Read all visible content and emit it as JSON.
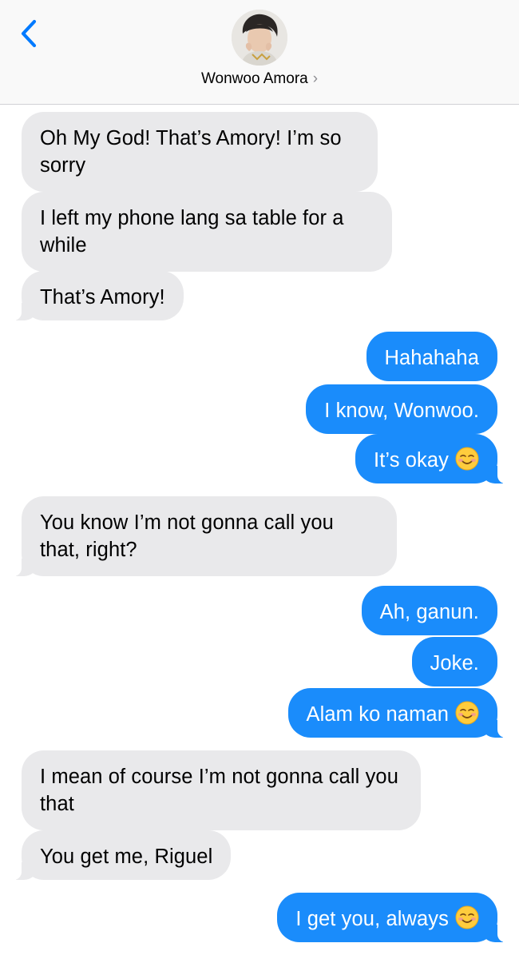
{
  "header": {
    "contact_name": "Wonwoo Amora",
    "chevron": "›"
  },
  "icons": {
    "back": "back-chevron-icon",
    "avatar": "contact-avatar",
    "emoji": "smiling-face-emoji"
  },
  "colors": {
    "outgoing": "#1a8cfb",
    "incoming": "#e9e9eb",
    "accent": "#007aff"
  },
  "messages": [
    {
      "side": "in",
      "text": "Oh My God! That’s Amory! I’m so sorry"
    },
    {
      "side": "in",
      "text": "I left my phone lang sa table for a while"
    },
    {
      "side": "in",
      "text": "That’s Amory!"
    },
    {
      "side": "out",
      "text": "Hahahaha"
    },
    {
      "side": "out",
      "text": "I know, Wonwoo."
    },
    {
      "side": "out",
      "text": "It’s okay",
      "emoji": "☺️"
    },
    {
      "side": "in",
      "text": "You know I’m not gonna call you that, right?"
    },
    {
      "side": "out",
      "text": "Ah, ganun."
    },
    {
      "side": "out",
      "text": "Joke."
    },
    {
      "side": "out",
      "text": "Alam ko naman",
      "emoji": "☺️"
    },
    {
      "side": "in",
      "text": "I mean of course I’m not gonna call you that"
    },
    {
      "side": "in",
      "text": "You get me, Riguel"
    },
    {
      "side": "out",
      "text": "I get you, always",
      "emoji": "☺️"
    }
  ]
}
